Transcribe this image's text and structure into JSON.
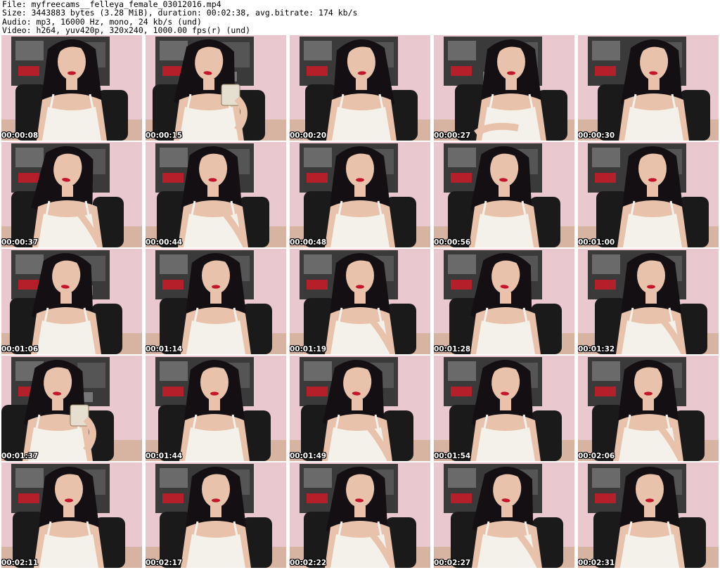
{
  "header": {
    "file_line": "File: myfreecams__felleya_female_03012016.mp4",
    "size_line": "Size: 3443883 bytes (3.28 MiB), duration: 00:02:38, avg.bitrate: 174 kb/s",
    "audio_line": "Audio: mp3, 16000 Hz, mono, 24 kb/s (und)",
    "video_line": "Video: h264, yuv420p, 320x240, 1000.00 fps(r) (und)"
  },
  "thumbnails": [
    {
      "time": "00:00:08"
    },
    {
      "time": "00:00:15"
    },
    {
      "time": "00:00:20"
    },
    {
      "time": "00:00:27"
    },
    {
      "time": "00:00:30"
    },
    {
      "time": "00:00:37"
    },
    {
      "time": "00:00:44"
    },
    {
      "time": "00:00:48"
    },
    {
      "time": "00:00:56"
    },
    {
      "time": "00:01:00"
    },
    {
      "time": "00:01:06"
    },
    {
      "time": "00:01:14"
    },
    {
      "time": "00:01:19"
    },
    {
      "time": "00:01:28"
    },
    {
      "time": "00:01:32"
    },
    {
      "time": "00:01:37"
    },
    {
      "time": "00:01:44"
    },
    {
      "time": "00:01:49"
    },
    {
      "time": "00:01:54"
    },
    {
      "time": "00:02:06"
    },
    {
      "time": "00:02:11"
    },
    {
      "time": "00:02:17"
    },
    {
      "time": "00:02:22"
    },
    {
      "time": "00:02:27"
    },
    {
      "time": "00:02:31"
    }
  ],
  "colors": {
    "wall": "#e9c8cf",
    "floor": "#c9a47e",
    "poster": "#3a3a3a",
    "poster_accent": "#b51f2a",
    "hair": "#140f12",
    "skin": "#e8c2aa",
    "dress": "#f4f1ea",
    "lips": "#c3162a",
    "chair": "#1a1a1a"
  }
}
